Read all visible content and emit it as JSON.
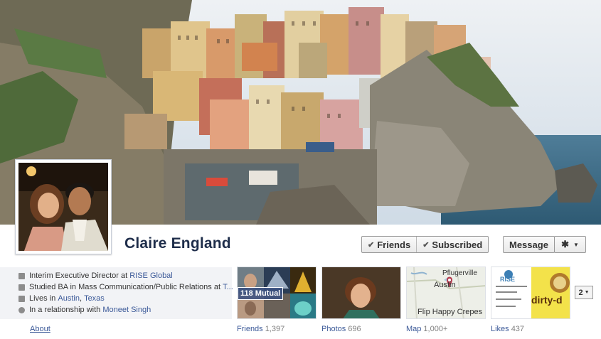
{
  "profile": {
    "name": "Claire England"
  },
  "actions": {
    "friends_label": "Friends",
    "subscribed_label": "Subscribed",
    "message_label": "Message"
  },
  "info": {
    "job_prefix": "Interim Executive Director at",
    "job_link": "RISE Global",
    "study_prefix": "Studied BA in Mass Communication/Public Relations at",
    "study_suffix": "T...",
    "lives_prefix": "Lives in",
    "city": "Austin",
    "comma": ",",
    "state": "Texas",
    "rel_prefix": "In a relationship with",
    "partner": "Moneet Singh"
  },
  "tabs": {
    "about": "About",
    "friends": "Friends",
    "friends_count": "1,397",
    "photos": "Photos",
    "photos_count": "696",
    "map": "Map",
    "map_count": "1,000+",
    "likes": "Likes",
    "likes_count": "437"
  },
  "friends_tile": {
    "mutual": "118 Mutual"
  },
  "map_tile": {
    "town": "Pflugerville",
    "city": "Austin",
    "caption": "Flip Happy Crepes"
  },
  "likes_tile": {
    "brand1": "RISE",
    "brand2": "dirty-d",
    "more_count": "2"
  },
  "colors": {
    "link": "#3b5998",
    "name": "#1e2d4a"
  }
}
